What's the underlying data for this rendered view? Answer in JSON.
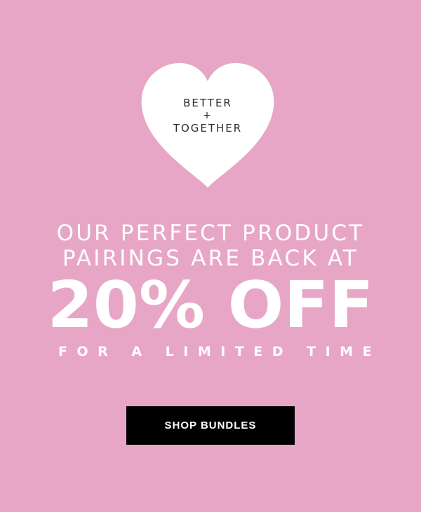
{
  "heart": {
    "line1": "BETTER",
    "plus": "+",
    "line2": "TOGETHER"
  },
  "headline": {
    "line1": "OUR PERFECT PRODUCT",
    "line2": "PAIRINGS ARE BACK AT",
    "discount": "20% OFF",
    "sub": "FOR A LIMITED TIME"
  },
  "cta": {
    "label": "SHOP BUNDLES"
  },
  "colors": {
    "background": "#e8a6c6",
    "heart": "#ffffff",
    "button": "#000000",
    "text": "#ffffff"
  }
}
